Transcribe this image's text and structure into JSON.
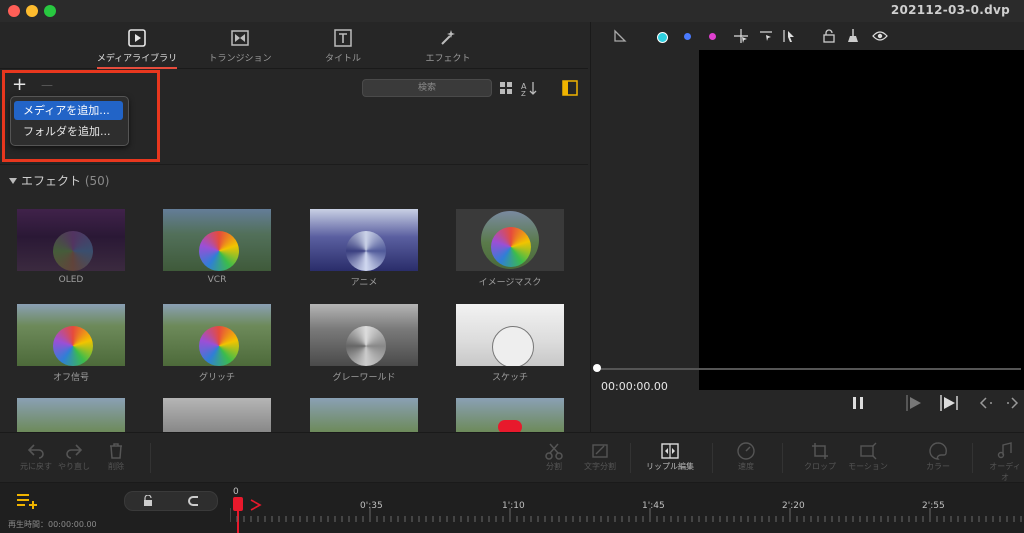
{
  "window": {
    "title": "202112-03-0.dvp",
    "traffic_lights": {
      "close": "#ff5f57",
      "minimize": "#febc2e",
      "zoom": "#28c840"
    }
  },
  "tabs": [
    {
      "label": "メディアライブラリ",
      "icon": "media-library-icon",
      "active": true
    },
    {
      "label": "トランジション",
      "icon": "transition-icon",
      "active": false
    },
    {
      "label": "タイトル",
      "icon": "title-icon",
      "active": false
    },
    {
      "label": "エフェクト",
      "icon": "effect-icon",
      "active": false
    }
  ],
  "library_toolbar": {
    "add_symbol": "+",
    "remove_symbol": "—",
    "search_placeholder": "検索"
  },
  "add_menu": {
    "items": [
      {
        "label": "メディアを追加...",
        "selected": true
      },
      {
        "label": "フォルダを追加...",
        "selected": false
      }
    ]
  },
  "effects": {
    "title": "エフェクト",
    "count": "(50)",
    "items": [
      {
        "label": "OLED"
      },
      {
        "label": "VCR"
      },
      {
        "label": "アニメ"
      },
      {
        "label": "イメージマスク"
      },
      {
        "label": "オフ信号"
      },
      {
        "label": "グリッチ"
      },
      {
        "label": "グレーワールド"
      },
      {
        "label": "スケッチ"
      }
    ]
  },
  "preview": {
    "timecode": "00:00:00.00"
  },
  "bottom_tools": [
    {
      "label": "元に戻す"
    },
    {
      "label": "やり直し"
    },
    {
      "label": "削除"
    },
    {
      "label": "分割"
    },
    {
      "label": "文字分割"
    },
    {
      "label": "リップル編集"
    },
    {
      "label": "速度"
    },
    {
      "label": "クロップ"
    },
    {
      "label": "モーション"
    },
    {
      "label": "カラー"
    },
    {
      "label": "オーディオ"
    }
  ],
  "timeline": {
    "playback_time": "再生時間：00:00:00.00",
    "ruler_labels": [
      "0",
      "0':35",
      "1':10",
      "1':45",
      "2':20",
      "2':55"
    ]
  },
  "colors": {
    "accent_red": "#e8371e",
    "menu_selected": "#2264c7",
    "tab_underline": "#e74c3c",
    "yellow_icon": "#f0b400"
  }
}
